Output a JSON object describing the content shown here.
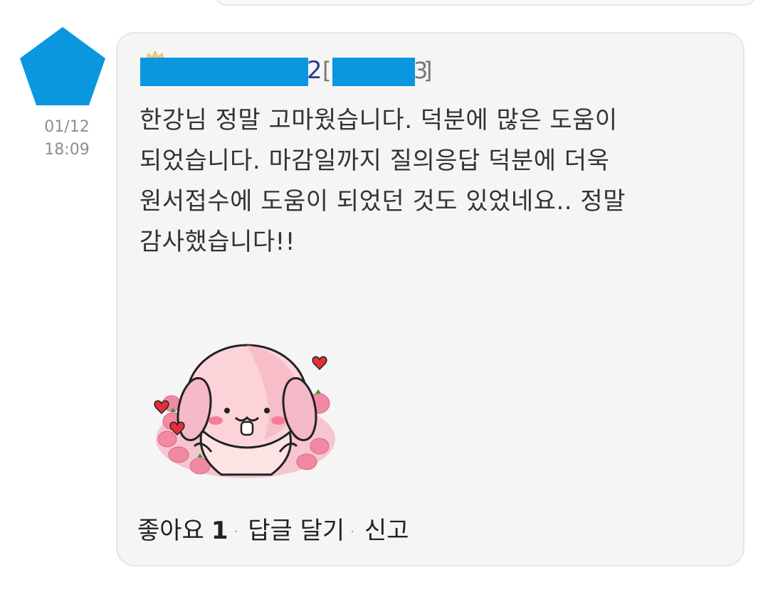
{
  "comment": {
    "date": "01/12",
    "time": "18:09",
    "author": {
      "name_tail": "2",
      "tag_tail": "3"
    },
    "text_lines": [
      "한강님 정말 고마웠습니다. 덕분에 많은 도움이",
      "되었습니다. 마감일까지 질의응답 덕분에 더욱",
      "원서접수에 도움이 되었던 것도 있었네요.. 정말",
      "감사했습니다!!"
    ]
  },
  "actions": {
    "like_label": "좋아요",
    "like_count": "1",
    "separator": "·",
    "reply_label": "답글 달기",
    "report_label": "신고"
  },
  "colors": {
    "avatar": "#0b96e0",
    "redaction": "#0b96e0",
    "card_bg": "#f5f5f5",
    "card_border": "#e6e6e6"
  }
}
